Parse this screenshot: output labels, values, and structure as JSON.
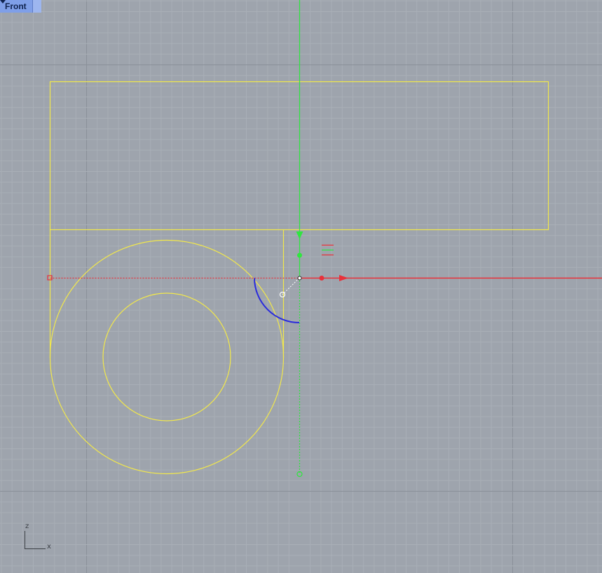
{
  "viewport": {
    "name": "Front",
    "menu_icon": "chevron-down-icon"
  },
  "axis_icon": {
    "vertical_label": "z",
    "horizontal_label": "x"
  },
  "colors": {
    "background": "#9ea4ad",
    "grid_minor": "#a9afb7",
    "grid_major": "#8a9099",
    "curves": "#f2e84b",
    "x_axis": "#e8313a",
    "z_axis": "#2fe63e",
    "arc_preview": "#2a2bdc",
    "tab": "#7f9fe8"
  }
}
